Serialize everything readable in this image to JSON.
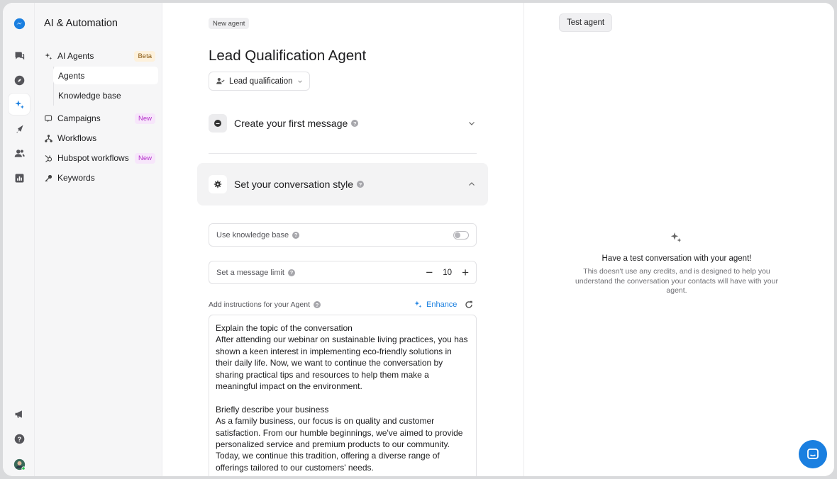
{
  "sidebar": {
    "title": "AI & Automation",
    "items": [
      {
        "label": "AI Agents",
        "badge": "Beta"
      },
      {
        "label": "Agents"
      },
      {
        "label": "Knowledge base"
      },
      {
        "label": "Campaigns",
        "badge": "New"
      },
      {
        "label": "Workflows"
      },
      {
        "label": "Hubspot workflows",
        "badge": "New"
      },
      {
        "label": "Keywords"
      }
    ]
  },
  "rail": {
    "icons": [
      "messenger-logo-icon",
      "chat-bubbles-icon",
      "compass-icon",
      "sparkles-icon",
      "rocket-icon",
      "contacts-icon",
      "chart-icon",
      "megaphone-icon",
      "help-icon",
      "avatar"
    ]
  },
  "main": {
    "tag": "New agent",
    "title": "Lead Qualification Agent",
    "goal_dropdown": "Lead qualification",
    "section_first_message": "Create your first message",
    "section_style": "Set your conversation style",
    "use_kb_label": "Use knowledge base",
    "message_limit_label": "Set a message limit",
    "message_limit_value": "10",
    "stepper_minus": "−",
    "stepper_plus": "+",
    "instructions_label": "Add instructions for your Agent",
    "enhance_label": "Enhance",
    "instructions_text": "Explain the topic of the conversation\nAfter attending our webinar on sustainable living practices, you has shown a keen interest in implementing eco-friendly solutions in their daily life. Now, we want to continue the conversation by sharing practical tips and resources to help them make a meaningful impact on the environment.\n\nBriefly describe your business\nAs a family business, our focus is on quality and customer satisfaction. From our humble beginnings, we've aimed to provide personalized service and premium products to our community. Today, we continue this tradition, offering a diverse range of offerings tailored to our customers' needs."
  },
  "test_panel": {
    "button": "Test agent",
    "empty_title": "Have a test conversation with your agent!",
    "empty_desc": "This doesn't use any credits, and is designed to help you understand the conversation your contacts will have with your agent."
  },
  "colors": {
    "accent": "#1a7fe0",
    "beta": "#8a5a13",
    "new": "#b430c9"
  }
}
